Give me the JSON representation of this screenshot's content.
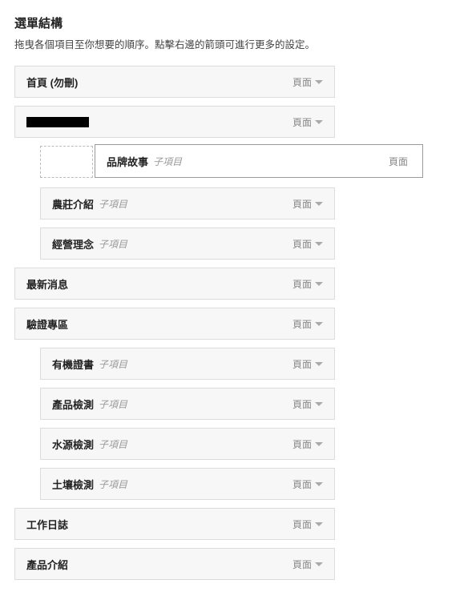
{
  "section": {
    "title": "選單結構",
    "description": "拖曳各個項目至你想要的順序。點擊右邊的箭頭可進行更多的設定。"
  },
  "labels": {
    "page_type": "頁面",
    "subitem": "子項目"
  },
  "dragging": {
    "title": "品牌故事"
  },
  "items": [
    {
      "title": "首頁 (勿刪)",
      "level": 0,
      "sub": false,
      "redacted": false
    },
    {
      "title": "",
      "level": 0,
      "sub": false,
      "redacted": true
    },
    {
      "title": "__DRAGGING__",
      "level": 1,
      "sub": true,
      "redacted": false
    },
    {
      "title": "農莊介紹",
      "level": 1,
      "sub": true,
      "redacted": false
    },
    {
      "title": "經營理念",
      "level": 1,
      "sub": true,
      "redacted": false
    },
    {
      "title": "最新消息",
      "level": 0,
      "sub": false,
      "redacted": false
    },
    {
      "title": "驗證專區",
      "level": 0,
      "sub": false,
      "redacted": false
    },
    {
      "title": "有機證書",
      "level": 1,
      "sub": true,
      "redacted": false
    },
    {
      "title": "產品檢測",
      "level": 1,
      "sub": true,
      "redacted": false
    },
    {
      "title": "水源檢測",
      "level": 1,
      "sub": true,
      "redacted": false
    },
    {
      "title": "土壤檢測",
      "level": 1,
      "sub": true,
      "redacted": false
    },
    {
      "title": "工作日誌",
      "level": 0,
      "sub": false,
      "redacted": false
    },
    {
      "title": "產品介紹",
      "level": 0,
      "sub": false,
      "redacted": false
    }
  ]
}
